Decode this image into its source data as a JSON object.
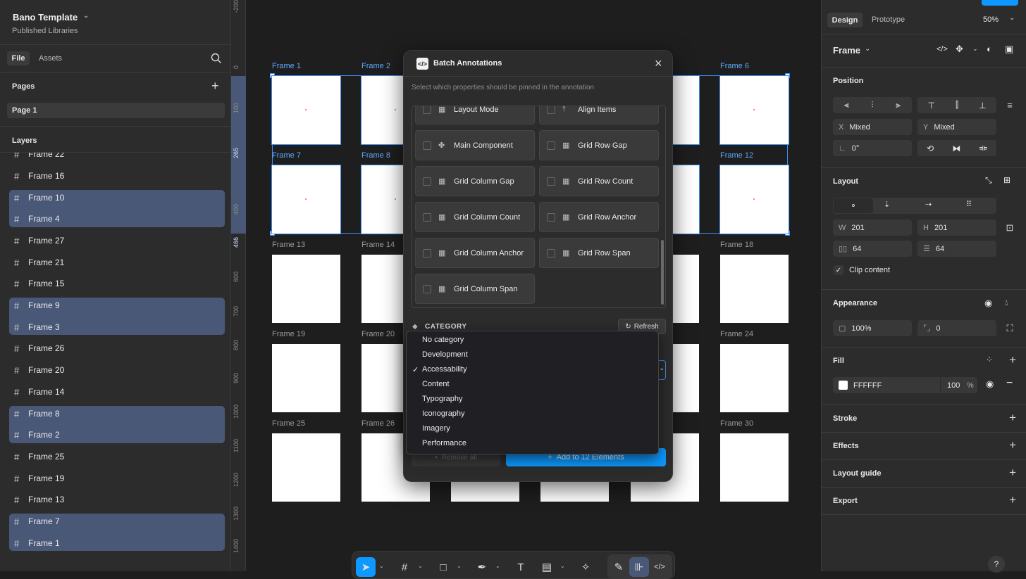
{
  "file": {
    "name": "Bano Template",
    "subtitle": "Published Libraries"
  },
  "left_tabs": [
    "File",
    "Assets"
  ],
  "pages": {
    "title": "Pages",
    "items": [
      "Page 1"
    ]
  },
  "layers": {
    "title": "Layers",
    "items": [
      "Frame 22",
      "Frame 16",
      "Frame 10",
      "Frame 4",
      "Frame 27",
      "Frame 21",
      "Frame 15",
      "Frame 9",
      "Frame 3",
      "Frame 26",
      "Frame 20",
      "Frame 14",
      "Frame 8",
      "Frame 2",
      "Frame 25",
      "Frame 19",
      "Frame 13",
      "Frame 7",
      "Frame 1"
    ],
    "selected": [
      "Frame 10",
      "Frame 4",
      "Frame 9",
      "Frame 3",
      "Frame 8",
      "Frame 2",
      "Frame 7",
      "Frame 1"
    ]
  },
  "ruler": {
    "marks": [
      "-200",
      "0",
      "100",
      "265",
      "400",
      "466",
      "600",
      "700",
      "800",
      "900",
      "1000",
      "1100",
      "1200",
      "1300",
      "1400"
    ]
  },
  "canvas": {
    "frame_labels": {
      "row1": [
        "Frame 1",
        "Frame 2",
        "Frame 6"
      ],
      "row2": [
        "Frame 7",
        "Frame 8",
        "Frame 12"
      ],
      "row3": [
        "Frame 13",
        "Frame 14",
        "Frame 18"
      ],
      "row4": [
        "Frame 19",
        "Frame 20",
        "Frame 24"
      ],
      "row5": [
        "Frame 25",
        "Frame 26",
        "Frame 30"
      ]
    }
  },
  "dialog": {
    "title": "Batch Annotations",
    "subtitle": "Select which properties should be pinned in the annotation",
    "partial_row": [
      "Layout Mode",
      "Align Items"
    ],
    "properties": [
      "Main Component",
      "Grid Row Gap",
      "Grid Column Gap",
      "Grid Row Count",
      "Grid Column Count",
      "Grid Row Anchor",
      "Grid Column Anchor",
      "Grid Row Span",
      "Grid Column Span"
    ],
    "category_label": "CATEGORY",
    "refresh_label": "Refresh",
    "remove_label": "Remove all",
    "add_label": "Add to 12 Elements"
  },
  "category_menu": {
    "options": [
      "No category",
      "Development",
      "Accessability",
      "Content",
      "Typography",
      "Iconography",
      "Imagery",
      "Performance"
    ],
    "selected": "Accessability"
  },
  "right": {
    "tabs": [
      "Design",
      "Prototype"
    ],
    "zoom": "50%",
    "frame_title": "Frame",
    "position": {
      "title": "Position",
      "x_label": "X",
      "x": "Mixed",
      "y_label": "Y",
      "y": "Mixed",
      "rotation": "0°"
    },
    "layout": {
      "title": "Layout",
      "w_label": "W",
      "w": "201",
      "h_label": "H",
      "h": "201",
      "gap_h": "64",
      "gap_v": "64",
      "clip": "Clip content"
    },
    "appearance": {
      "title": "Appearance",
      "opacity": "100%",
      "radius": "0"
    },
    "fill": {
      "title": "Fill",
      "hex": "FFFFFF",
      "opacity": "100",
      "unit": "%"
    },
    "sections": [
      "Stroke",
      "Effects",
      "Layout guide",
      "Export"
    ]
  },
  "colors": {
    "accent": "#0d99ff",
    "selection": "#4a5878",
    "frame_blue": "#3d8ef0"
  }
}
